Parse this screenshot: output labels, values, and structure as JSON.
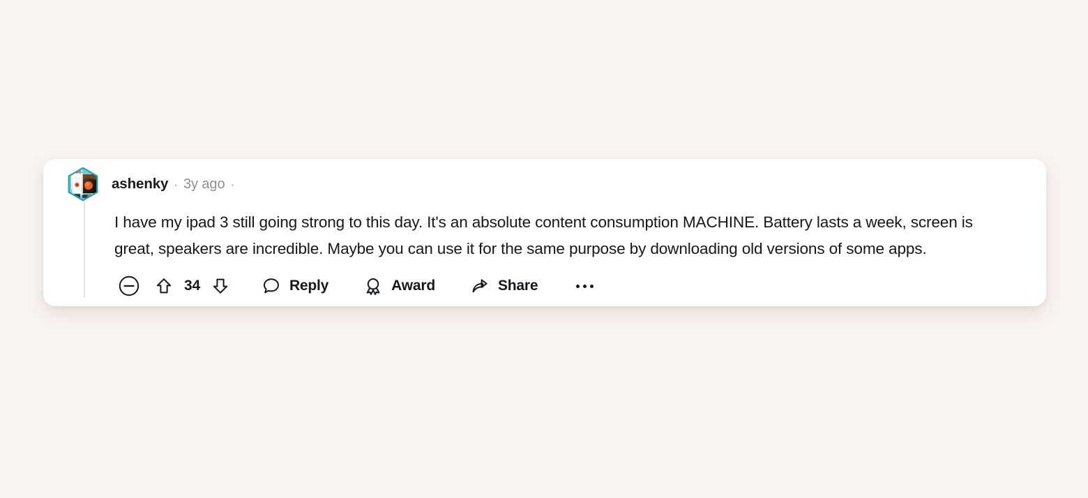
{
  "theme": {
    "page_background": "#faf4f0",
    "card_background": "#ffffff",
    "text_primary": "#15181a",
    "text_muted": "#8b9096",
    "thread_line": "#e3e1df"
  },
  "comment": {
    "author": "ashenky",
    "separator_left": "·",
    "timestamp": "3y ago",
    "separator_right": "·",
    "avatar_icon": "hexagon-astronaut-avatar",
    "body": "I have my ipad 3 still going strong to this day. It's an absolute content consumption MACHINE. Battery lasts a week, screen is great, speakers are incredible. Maybe you can use it for the same purpose by downloading old versions of some apps.",
    "actions": {
      "collapse": {
        "icon": "minus-circle-icon",
        "label": ""
      },
      "upvote": {
        "icon": "upvote-arrow-icon",
        "label": ""
      },
      "score": "34",
      "downvote": {
        "icon": "downvote-arrow-icon",
        "label": ""
      },
      "reply": {
        "icon": "comment-bubble-icon",
        "label": "Reply"
      },
      "award": {
        "icon": "award-rosette-icon",
        "label": "Award"
      },
      "share": {
        "icon": "share-arrow-icon",
        "label": "Share"
      },
      "more": {
        "icon": "ellipsis-icon",
        "label": ""
      }
    }
  }
}
